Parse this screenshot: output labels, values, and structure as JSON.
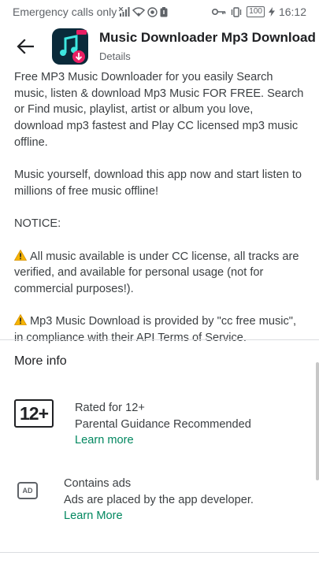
{
  "status_bar": {
    "carrier": "Emergency calls only",
    "battery": "100",
    "time": "16:12"
  },
  "header": {
    "title": "Music Downloader Mp3 Download",
    "subtitle": "Details",
    "back_icon": "arrow-left-icon",
    "app_icon": "music-download-app-icon"
  },
  "description": {
    "p1": "Free MP3 Music Downloader for you easily Search music, listen & download Mp3 Music FOR FREE. Search or Find music, playlist, artist or album you love, download mp3 fastest and Play CC licensed mp3 music offline.",
    "p2": "Music yourself, download this app now and start listen to millions of free music offline!",
    "p3": "NOTICE:",
    "p4": "All music available is under CC license, all tracks are verified, and available for personal usage (not for commercial purposes!).",
    "p5": "Mp3 Music Download is provided by \"cc free music\", in compliance with their API Terms of Service."
  },
  "more_info": {
    "title": "More info",
    "rating": {
      "badge": "12+",
      "line1": "Rated for 12+",
      "line2": "Parental Guidance Recommended",
      "link": "Learn more"
    },
    "ads": {
      "badge": "AD",
      "line1": "Contains ads",
      "line2": "Ads are placed by the app developer.",
      "link": "Learn More"
    }
  },
  "colors": {
    "link_green": "#01875f",
    "app_icon_bg": "#0a2a3a",
    "app_icon_accent": "#e91e63"
  }
}
